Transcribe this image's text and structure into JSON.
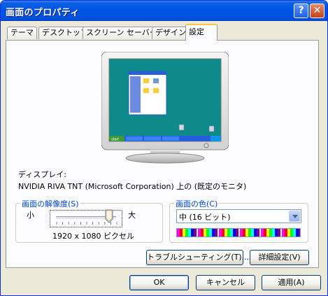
{
  "window": {
    "title": "画面のプロパティ"
  },
  "titlebar": {
    "help_glyph": "?",
    "close_glyph": "✕"
  },
  "tabs": [
    {
      "label": "テーマ"
    },
    {
      "label": "デスクトップ"
    },
    {
      "label": "スクリーン セーバー"
    },
    {
      "label": "デザイン"
    },
    {
      "label": "設定"
    }
  ],
  "active_tab_index": 4,
  "display": {
    "label": "ディスプレイ:",
    "value": "NVIDIA RIVA TNT (Microsoft Corporation) 上の (既定のモニタ)"
  },
  "resolution": {
    "group_label": "画面の解像度(S)",
    "min_label": "小",
    "max_label": "大",
    "value_text": "1920 x 1080 ピクセル",
    "slider_fraction": 0.88
  },
  "color_quality": {
    "group_label": "画面の色(C)",
    "selected": "中 (16 ビット)"
  },
  "buttons": {
    "troubleshoot": "トラブルシューティング(T)...",
    "advanced": "詳細設定(V)",
    "ok": "OK",
    "cancel": "キャンセル",
    "apply": "適用(A)"
  },
  "preview": {
    "start_label": "start"
  },
  "colors": {
    "accent": "#0054e3",
    "group_label": "#0046d5",
    "desktop_bg": "#0e8a8a",
    "taskbar": "#245edb"
  }
}
